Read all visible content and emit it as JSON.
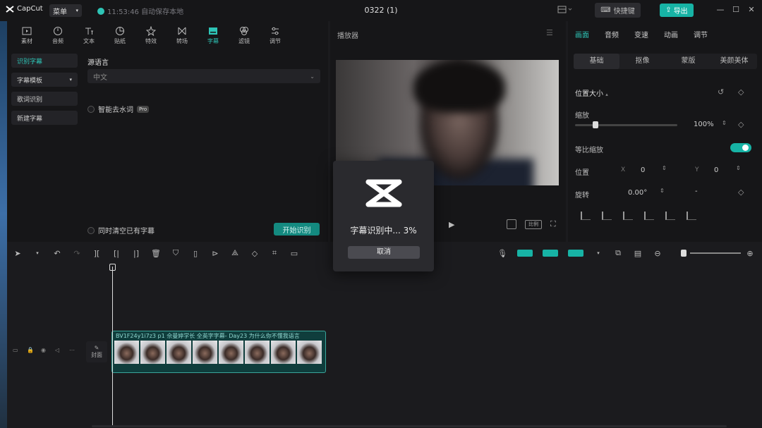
{
  "titlebar": {
    "app_name": "CapCut",
    "menu_label": "菜单",
    "save_status": "11:53:46 自动保存本地",
    "project_title": "0322 (1)",
    "shortcut_label": "快捷键",
    "export_label": "导出"
  },
  "toolbar": {
    "items": [
      {
        "label": "素材",
        "icon": "media-icon"
      },
      {
        "label": "音频",
        "icon": "audio-icon"
      },
      {
        "label": "文本",
        "icon": "text-icon"
      },
      {
        "label": "贴纸",
        "icon": "sticker-icon"
      },
      {
        "label": "特效",
        "icon": "effects-icon"
      },
      {
        "label": "转场",
        "icon": "transition-icon"
      },
      {
        "label": "字幕",
        "icon": "caption-icon"
      },
      {
        "label": "滤镜",
        "icon": "filter-icon"
      },
      {
        "label": "调节",
        "icon": "adjust-icon"
      }
    ],
    "active": "字幕"
  },
  "captions": {
    "nav": [
      "识别字幕",
      "字幕模板",
      "歌词识别",
      "新建字幕"
    ],
    "source_language_label": "源语言",
    "source_language_value": "中文",
    "filler_word_label": "智能去水词",
    "pro_badge": "Pro",
    "clear_existing_label": "同时清空已有字幕",
    "start_button": "开始识别"
  },
  "player": {
    "title": "播放器",
    "ratio_label": "比例"
  },
  "inspector": {
    "tabs": [
      "画面",
      "音频",
      "变速",
      "动画",
      "调节"
    ],
    "active_tab": "画面",
    "subtabs": [
      "基础",
      "抠像",
      "蒙版",
      "美颜美体"
    ],
    "active_subtab": "基础",
    "position_size_label": "位置大小",
    "scale_label": "缩放",
    "scale_value": "100%",
    "scale_fraction": 0.2,
    "uniform_scale_label": "等比缩放",
    "uniform_scale_on": true,
    "position_label": "位置",
    "x_label": "X",
    "x_value": "0",
    "y_label": "Y",
    "y_value": "0",
    "rotation_label": "旋转",
    "rotation_value": "0.00°",
    "rotation_extra": "-"
  },
  "timeline": {
    "cover_label": "封面",
    "clip_label": "BV1F24y1i7z3 p1 佘曼婷学长 全英字字幕- Day23 为什么你不懂我语言"
  },
  "modal": {
    "progress_text": "字幕识别中... 3%",
    "progress_percent": 3,
    "cancel_label": "取消"
  },
  "colors": {
    "accent": "#2ec4b6",
    "export": "#17b3a5"
  }
}
